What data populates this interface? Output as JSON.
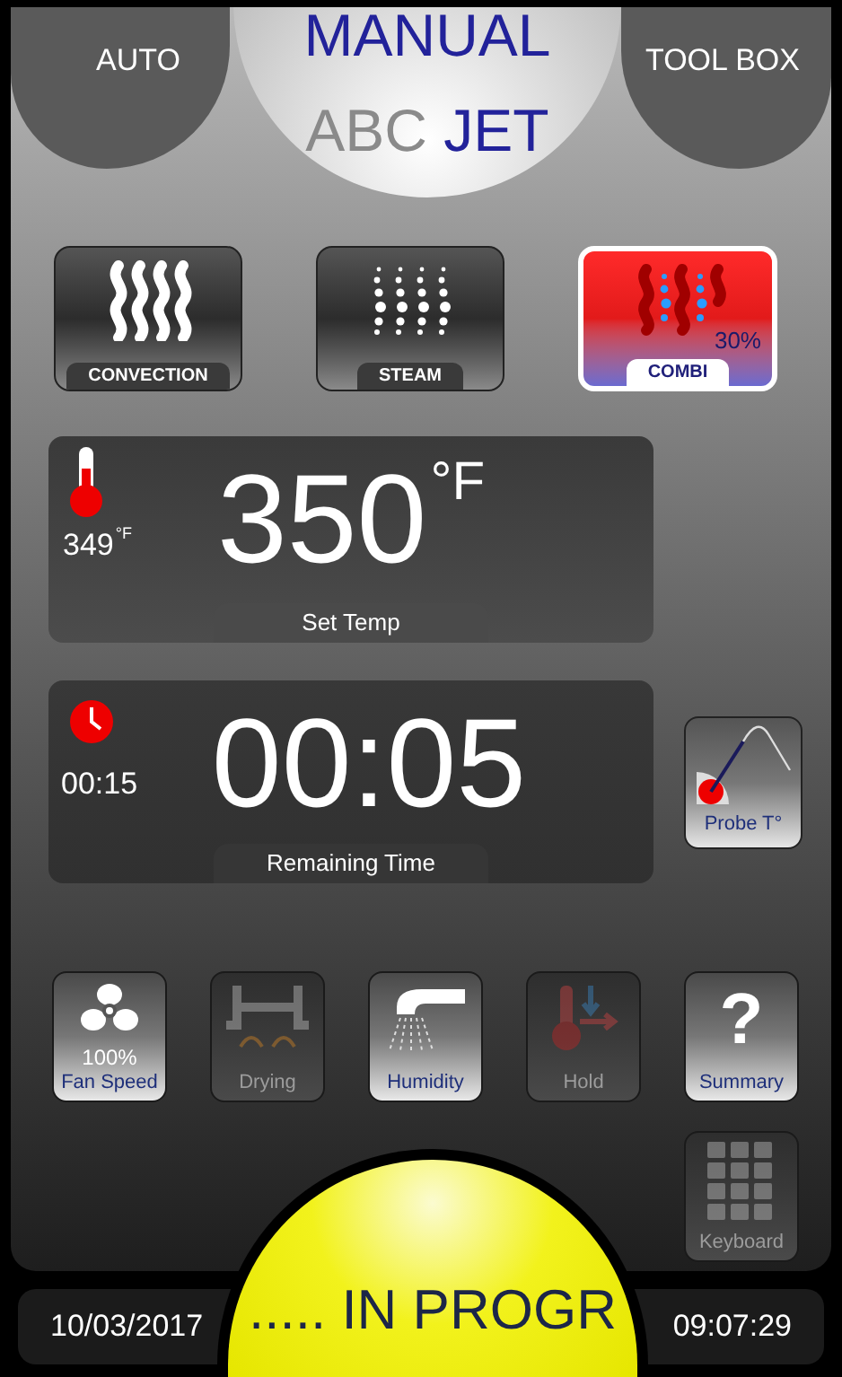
{
  "mode_tabs": [
    {
      "label": "AUTO",
      "selected": false
    },
    {
      "label": "MANUAL",
      "selected": true
    },
    {
      "label": "TOOL BOX",
      "selected": false
    }
  ],
  "program_name": {
    "prefix": "ABC",
    "name": "JET"
  },
  "cooking_modes": [
    {
      "kind": "convection",
      "label": "CONVECTION",
      "selected": false
    },
    {
      "kind": "steam",
      "label": "STEAM",
      "selected": false
    },
    {
      "kind": "combi",
      "label": "COMBI",
      "selected": true,
      "humidity": "30%"
    }
  ],
  "temperature": {
    "current": "349",
    "current_unit": "°F",
    "set": "350",
    "set_unit": "°F",
    "label": "Set Temp"
  },
  "time": {
    "elapsed": "00:15",
    "remaining": "00:05",
    "label": "Remaining Time"
  },
  "probe": {
    "label": "Probe T°"
  },
  "functions": [
    {
      "kind": "fan",
      "label": "Fan Speed",
      "value": "100%",
      "disabled": false
    },
    {
      "kind": "drying",
      "label": "Drying",
      "disabled": true
    },
    {
      "kind": "humidity",
      "label": "Humidity",
      "disabled": false
    },
    {
      "kind": "hold",
      "label": "Hold",
      "disabled": true
    },
    {
      "kind": "summary",
      "label": "Summary",
      "glyph": "?",
      "disabled": false
    }
  ],
  "extra_function": {
    "kind": "keyboard",
    "label": "Keyboard",
    "disabled": true
  },
  "status_bar": {
    "date": "10/03/2017",
    "progress_text": "..... IN PROGR",
    "time": "09:07:29"
  }
}
